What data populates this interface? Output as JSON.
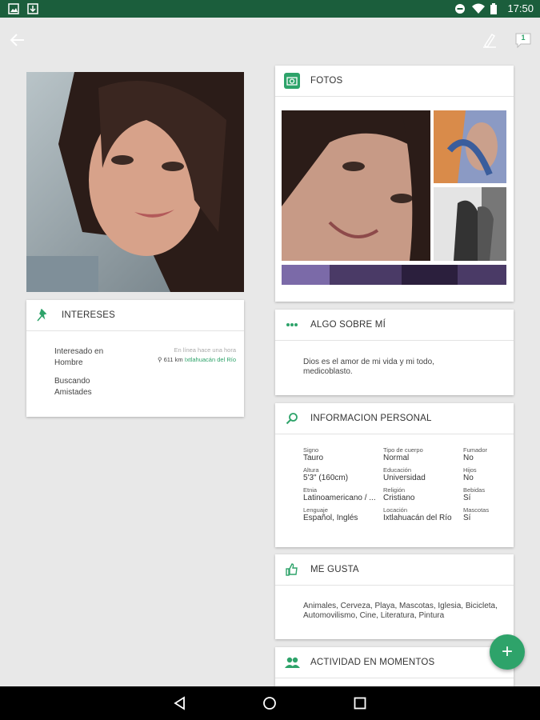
{
  "status_bar": {
    "time": "17:50"
  },
  "toolbar": {
    "badge_count": "1"
  },
  "intereses": {
    "title": "INTERESES",
    "interested_label": "Interesado en",
    "interested_value": "Hombre",
    "seeking_label": "Buscando",
    "seeking_value": "Amistades",
    "online": "En línea hace una hora",
    "distance": "611 km",
    "place": "Ixtlahuacán del Río"
  },
  "fotos": {
    "title": "FOTOS"
  },
  "about": {
    "title": "ALGO SOBRE MÍ",
    "text": "Dios es el amor de mi vida y mi todo, medicoblasto."
  },
  "personal": {
    "title": "INFORMACION PERSONAL",
    "fields": [
      {
        "label": "Signo",
        "value": "Tauro"
      },
      {
        "label": "Tipo de cuerpo",
        "value": "Normal"
      },
      {
        "label": "Fumador",
        "value": "No"
      },
      {
        "label": "Altura",
        "value": "5'3\" (160cm)"
      },
      {
        "label": "Educación",
        "value": "Universidad"
      },
      {
        "label": "Hijos",
        "value": "No"
      },
      {
        "label": "Etnia",
        "value": "Latinoamericano / ..."
      },
      {
        "label": "Religión",
        "value": "Cristiano"
      },
      {
        "label": "Bebidas",
        "value": "Sí"
      },
      {
        "label": "Lenguaje",
        "value": "Español, Inglés"
      },
      {
        "label": "Locación",
        "value": "Ixtlahuacán del Río"
      },
      {
        "label": "Mascotas",
        "value": "Sí"
      }
    ]
  },
  "likes": {
    "title": "ME GUSTA",
    "text": "Animales, Cerveza, Playa, Mascotas, Iglesia, Bicicleta, Automovilismo, Cine, Literatura, Pintura"
  },
  "activity": {
    "title": "ACTIVIDAD EN MOMENTOS"
  },
  "fab": {
    "label": "+"
  },
  "colors": {
    "accent": "#2ea36a",
    "status_bar": "#1b5e3c"
  }
}
